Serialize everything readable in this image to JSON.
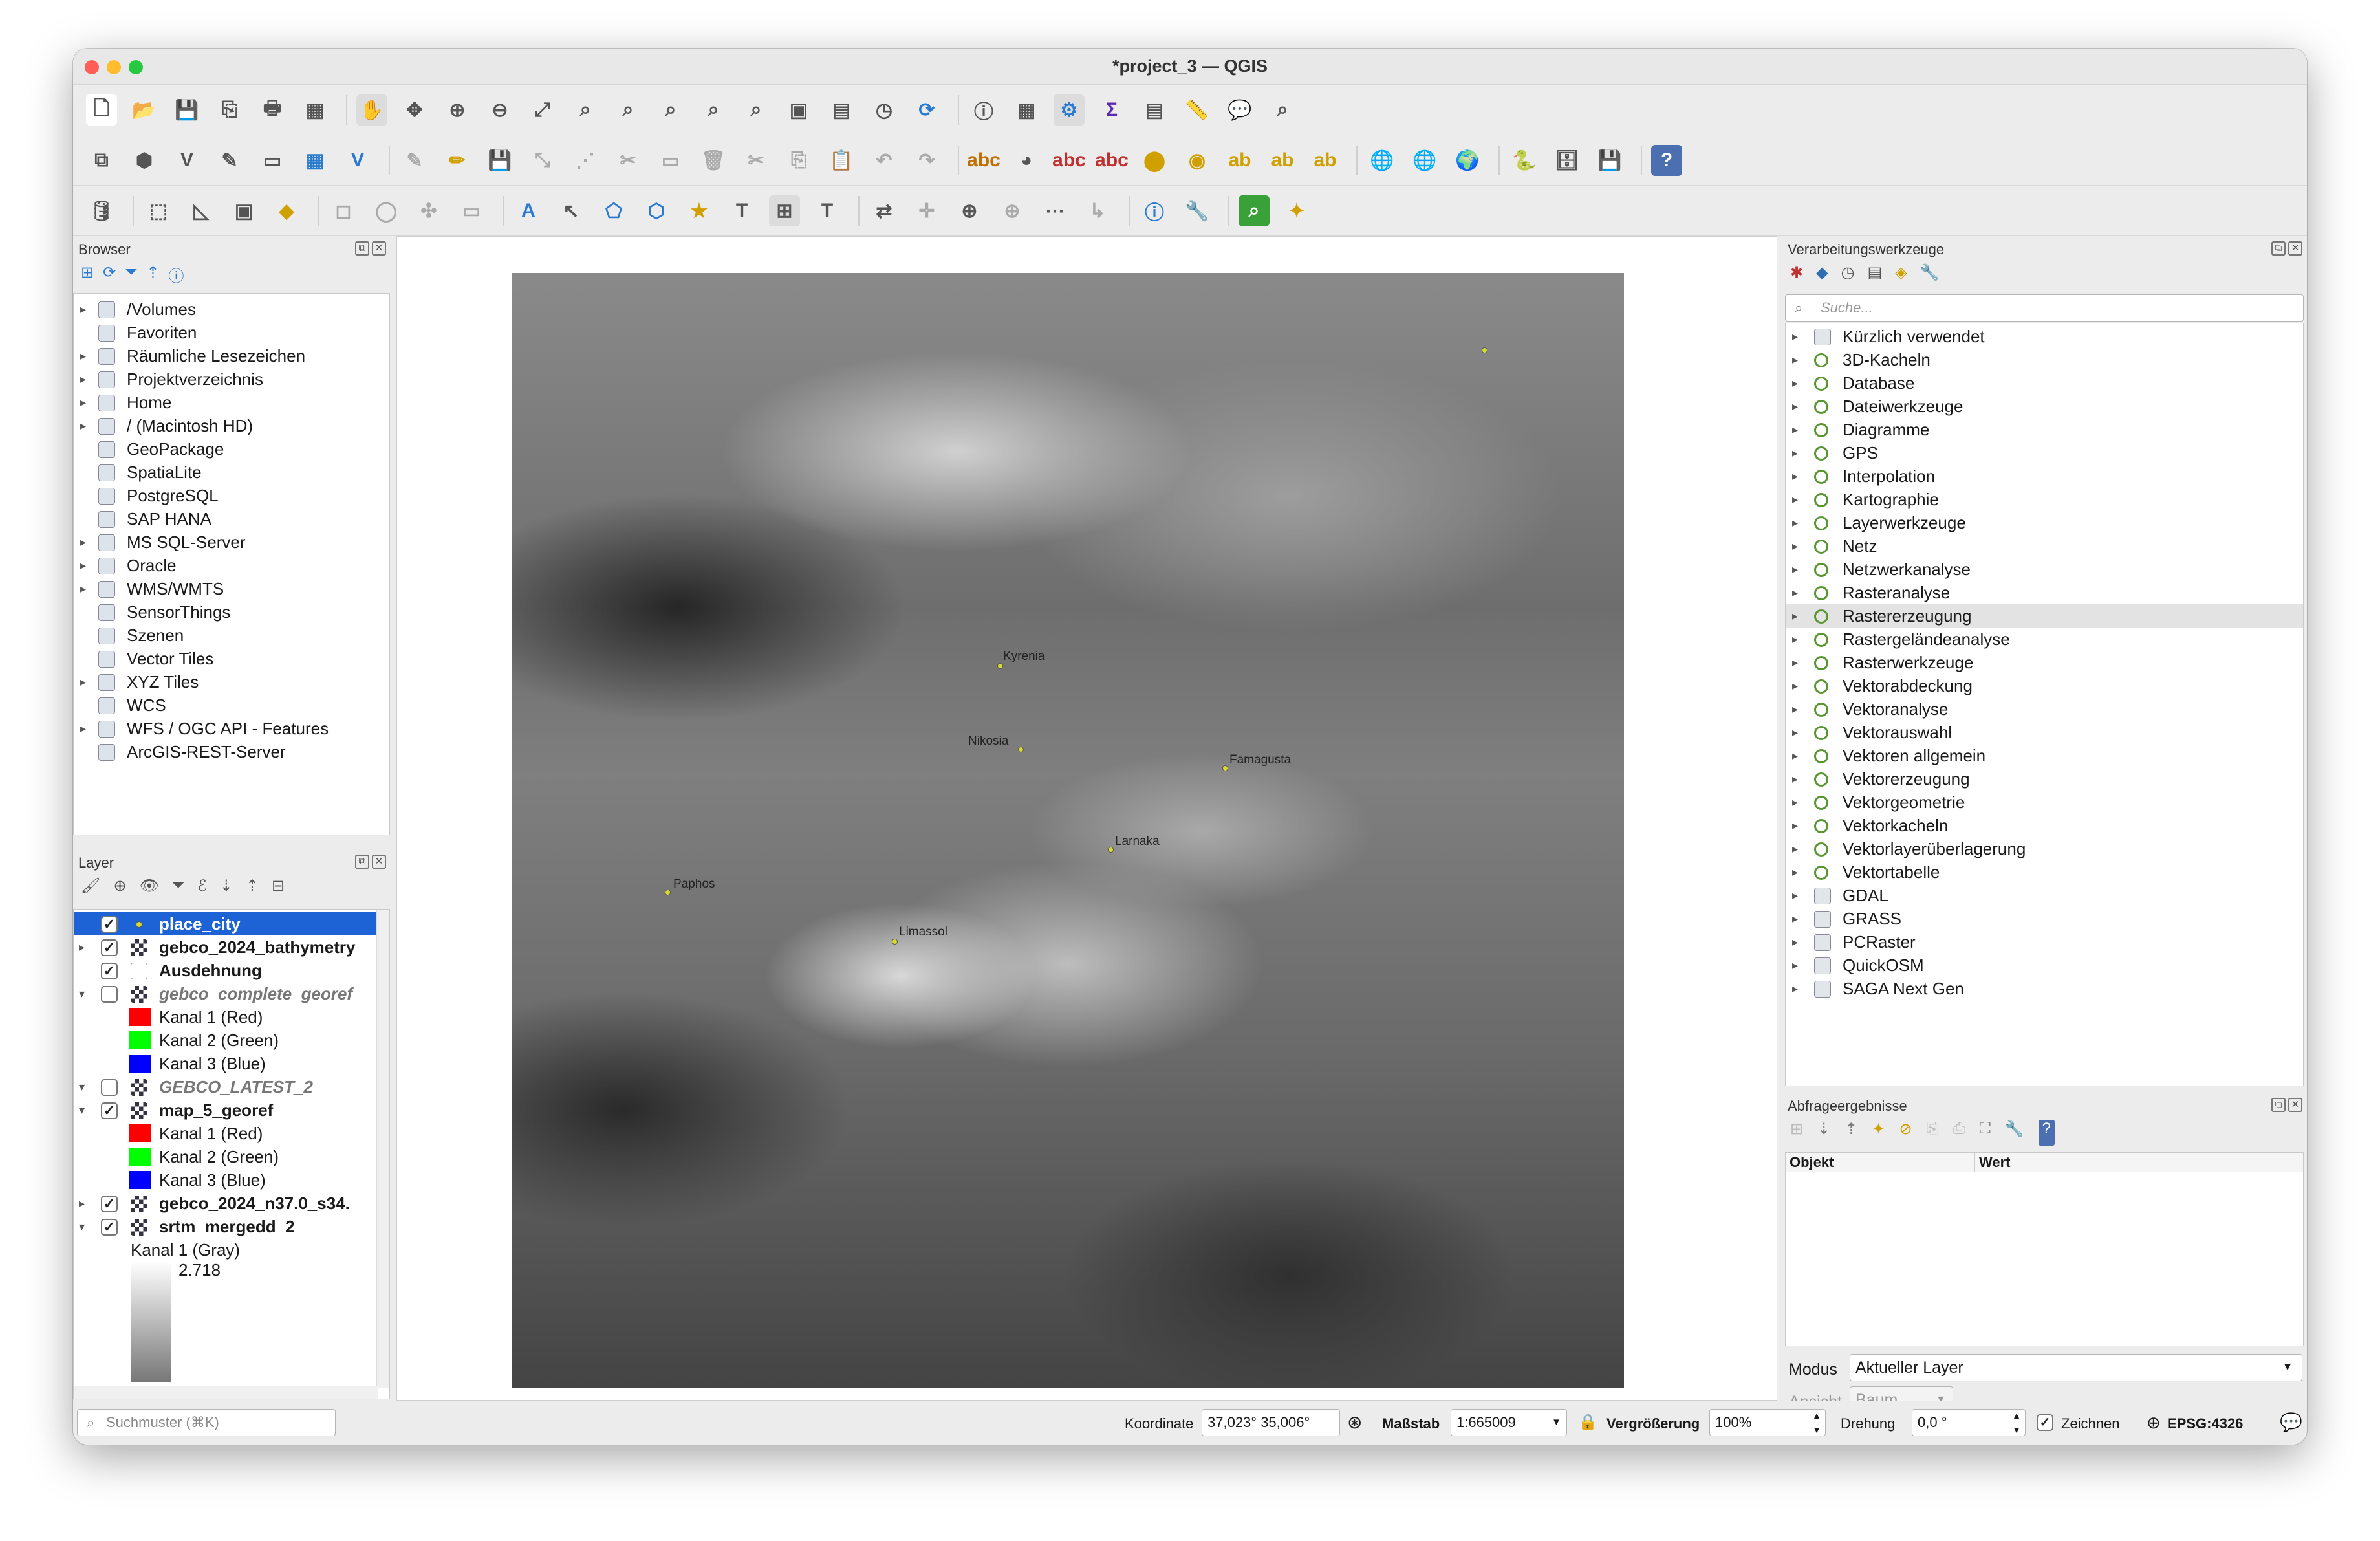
{
  "window": {
    "title": "*project_3 — QGIS"
  },
  "browser": {
    "title": "Browser",
    "items": [
      {
        "label": "/Volumes",
        "arrow": true,
        "icon": "folder-icon"
      },
      {
        "label": "Favoriten",
        "arrow": false,
        "icon": "star-icon"
      },
      {
        "label": "Räumliche Lesezeichen",
        "arrow": true,
        "icon": "bookmark-icon"
      },
      {
        "label": "Projektverzeichnis",
        "arrow": true,
        "icon": "project-folder-icon"
      },
      {
        "label": "Home",
        "arrow": true,
        "icon": "home-icon"
      },
      {
        "label": "/ (Macintosh HD)",
        "arrow": true,
        "icon": "folder-icon"
      },
      {
        "label": "GeoPackage",
        "arrow": false,
        "icon": "geopackage-icon"
      },
      {
        "label": "SpatiaLite",
        "arrow": false,
        "icon": "spatialite-icon"
      },
      {
        "label": "PostgreSQL",
        "arrow": false,
        "icon": "postgresql-icon"
      },
      {
        "label": "SAP HANA",
        "arrow": false,
        "icon": "sap-hana-icon"
      },
      {
        "label": "MS SQL-Server",
        "arrow": true,
        "icon": "mssql-icon"
      },
      {
        "label": "Oracle",
        "arrow": true,
        "icon": "oracle-icon"
      },
      {
        "label": "WMS/WMTS",
        "arrow": true,
        "icon": "globe-icon"
      },
      {
        "label": "SensorThings",
        "arrow": false,
        "icon": "sensor-icon"
      },
      {
        "label": "Szenen",
        "arrow": false,
        "icon": "scene-icon"
      },
      {
        "label": "Vector Tiles",
        "arrow": false,
        "icon": "grid-icon"
      },
      {
        "label": "XYZ Tiles",
        "arrow": true,
        "icon": "grid-icon"
      },
      {
        "label": "WCS",
        "arrow": false,
        "icon": "globe-icon"
      },
      {
        "label": "WFS / OGC API - Features",
        "arrow": true,
        "icon": "wfs-icon"
      },
      {
        "label": "ArcGIS-REST-Server",
        "arrow": false,
        "icon": "arcgis-icon"
      }
    ]
  },
  "layers": {
    "title": "Layer",
    "items": [
      {
        "label": "place_city",
        "checked": true,
        "bold": true,
        "italic": false,
        "selected": true,
        "indent": 0,
        "arrow": "",
        "kind": "point"
      },
      {
        "label": "gebco_2024_bathymetry",
        "checked": true,
        "bold": true,
        "italic": false,
        "selected": false,
        "indent": 0,
        "arrow": "▸",
        "kind": "raster"
      },
      {
        "label": "Ausdehnung",
        "checked": true,
        "bold": true,
        "italic": false,
        "selected": false,
        "indent": 0,
        "arrow": "",
        "kind": "polygon"
      },
      {
        "label": "gebco_complete_georef",
        "checked": false,
        "bold": true,
        "italic": true,
        "selected": false,
        "indent": 0,
        "arrow": "▾",
        "kind": "raster"
      },
      {
        "label": "Kanal 1 (Red)",
        "checked": null,
        "bold": false,
        "italic": false,
        "selected": false,
        "indent": 1,
        "arrow": "",
        "kind": "swatch",
        "color": "#ff0000"
      },
      {
        "label": "Kanal 2 (Green)",
        "checked": null,
        "bold": false,
        "italic": false,
        "selected": false,
        "indent": 1,
        "arrow": "",
        "kind": "swatch",
        "color": "#00ff00"
      },
      {
        "label": "Kanal 3 (Blue)",
        "checked": null,
        "bold": false,
        "italic": false,
        "selected": false,
        "indent": 1,
        "arrow": "",
        "kind": "swatch",
        "color": "#0000ff"
      },
      {
        "label": "GEBCO_LATEST_2",
        "checked": false,
        "bold": true,
        "italic": true,
        "selected": false,
        "indent": 0,
        "arrow": "▾",
        "kind": "raster"
      },
      {
        "label": "map_5_georef",
        "checked": true,
        "bold": true,
        "italic": false,
        "selected": false,
        "indent": 0,
        "arrow": "▾",
        "kind": "raster"
      },
      {
        "label": "Kanal 1 (Red)",
        "checked": null,
        "bold": false,
        "italic": false,
        "selected": false,
        "indent": 1,
        "arrow": "",
        "kind": "swatch",
        "color": "#ff0000"
      },
      {
        "label": "Kanal 2 (Green)",
        "checked": null,
        "bold": false,
        "italic": false,
        "selected": false,
        "indent": 1,
        "arrow": "",
        "kind": "swatch",
        "color": "#00ff00"
      },
      {
        "label": "Kanal 3 (Blue)",
        "checked": null,
        "bold": false,
        "italic": false,
        "selected": false,
        "indent": 1,
        "arrow": "",
        "kind": "swatch",
        "color": "#0000ff"
      },
      {
        "label": "gebco_2024_n37.0_s34.",
        "checked": true,
        "bold": true,
        "italic": false,
        "selected": false,
        "indent": 0,
        "arrow": "▸",
        "kind": "raster"
      },
      {
        "label": "srtm_mergedd_2",
        "checked": true,
        "bold": true,
        "italic": false,
        "selected": false,
        "indent": 0,
        "arrow": "▾",
        "kind": "raster"
      }
    ],
    "gray_band": "Kanal 1 (Gray)",
    "gray_max": "2.718"
  },
  "processing": {
    "title": "Verarbeitungswerkzeuge",
    "search_placeholder": "Suche...",
    "items": [
      {
        "label": "Kürzlich verwendet",
        "icon": "clock-icon"
      },
      {
        "label": "3D-Kacheln",
        "icon": "qgis-icon"
      },
      {
        "label": "Database",
        "icon": "qgis-icon"
      },
      {
        "label": "Dateiwerkzeuge",
        "icon": "qgis-icon"
      },
      {
        "label": "Diagramme",
        "icon": "qgis-icon"
      },
      {
        "label": "GPS",
        "icon": "qgis-icon"
      },
      {
        "label": "Interpolation",
        "icon": "qgis-icon"
      },
      {
        "label": "Kartographie",
        "icon": "qgis-icon"
      },
      {
        "label": "Layerwerkzeuge",
        "icon": "qgis-icon"
      },
      {
        "label": "Netz",
        "icon": "qgis-icon"
      },
      {
        "label": "Netzwerkanalyse",
        "icon": "qgis-icon"
      },
      {
        "label": "Rasteranalyse",
        "icon": "qgis-icon"
      },
      {
        "label": "Rastererzeugung",
        "icon": "qgis-icon",
        "highlight": true
      },
      {
        "label": "Rastergeländeanalyse",
        "icon": "qgis-icon"
      },
      {
        "label": "Rasterwerkzeuge",
        "icon": "qgis-icon"
      },
      {
        "label": "Vektorabdeckung",
        "icon": "qgis-icon"
      },
      {
        "label": "Vektoranalyse",
        "icon": "qgis-icon"
      },
      {
        "label": "Vektorauswahl",
        "icon": "qgis-icon"
      },
      {
        "label": "Vektoren allgemein",
        "icon": "qgis-icon"
      },
      {
        "label": "Vektorerzeugung",
        "icon": "qgis-icon"
      },
      {
        "label": "Vektorgeometrie",
        "icon": "qgis-icon"
      },
      {
        "label": "Vektorkacheln",
        "icon": "qgis-icon"
      },
      {
        "label": "Vektorlayerüberlagerung",
        "icon": "qgis-icon"
      },
      {
        "label": "Vektortabelle",
        "icon": "qgis-icon"
      },
      {
        "label": "GDAL",
        "icon": "gdal-icon"
      },
      {
        "label": "GRASS",
        "icon": "grass-icon"
      },
      {
        "label": "PCRaster",
        "icon": "pcraster-icon"
      },
      {
        "label": "QuickOSM",
        "icon": "quickosm-icon"
      },
      {
        "label": "SAGA Next Gen",
        "icon": "saga-icon"
      }
    ]
  },
  "identify": {
    "title": "Abfrageergebnisse",
    "col_object": "Objekt",
    "col_value": "Wert",
    "mode_label": "Modus",
    "mode_value": "Aktueller Layer",
    "view_label": "Ansicht",
    "view_value": "Baum"
  },
  "map": {
    "cities": [
      {
        "name": "Kyrenia"
      },
      {
        "name": "Nikosia"
      },
      {
        "name": "Famagusta"
      },
      {
        "name": "Larnaka"
      },
      {
        "name": "Paphos"
      },
      {
        "name": "Limassol"
      }
    ]
  },
  "status": {
    "search_placeholder": "Suchmuster (⌘K)",
    "coord_label": "Koordinate",
    "coord_value": "37,023°  35,006°",
    "scale_label": "Maßstab",
    "scale_value": "1:665009",
    "mag_label": "Vergrößerung",
    "mag_value": "100%",
    "rot_label": "Drehung",
    "rot_value": "0,0 °",
    "render_label": "Zeichnen",
    "crs": "EPSG:4326"
  },
  "colors": {
    "selection": "#1e63d6",
    "highlight": "#e3e3e3"
  }
}
